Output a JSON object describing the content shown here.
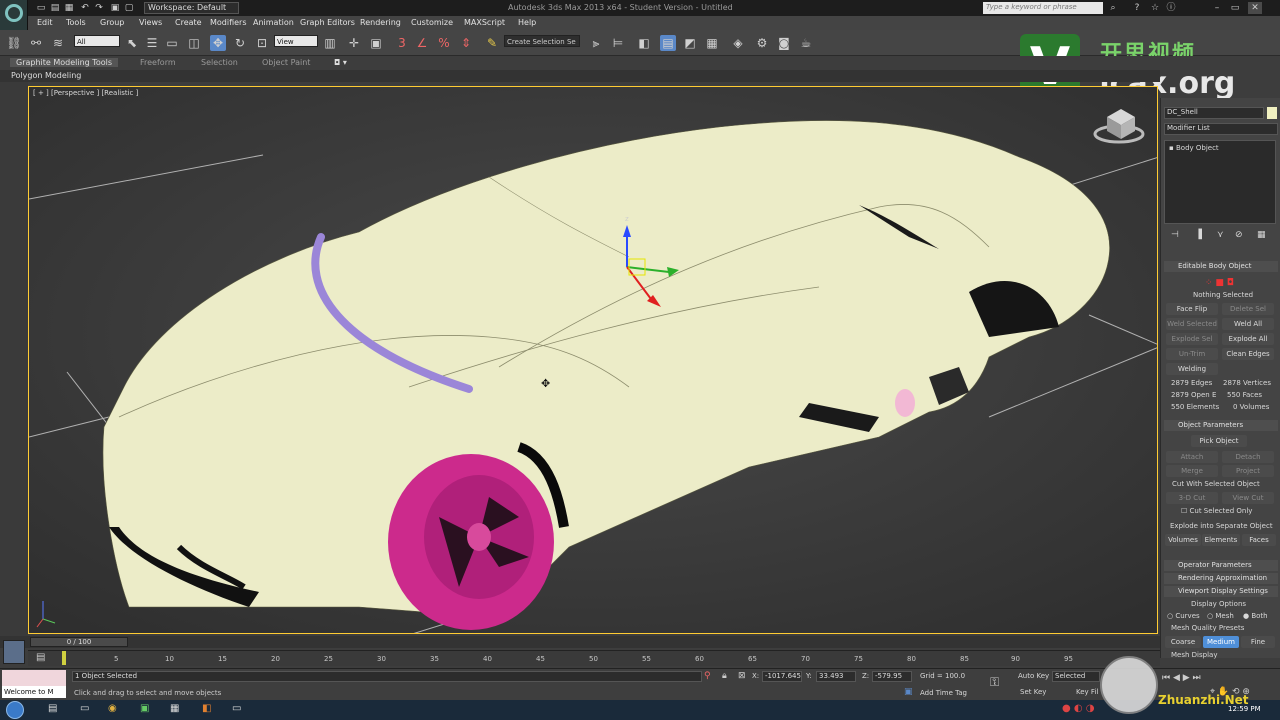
{
  "window": {
    "title": "Autodesk 3ds Max 2013 x64 - Student Version - Untitled",
    "workspace_label": "Workspace: Default",
    "search_placeholder": "Type a keyword or phrase"
  },
  "menu": [
    "Edit",
    "Tools",
    "Group",
    "Views",
    "Create",
    "Modifiers",
    "Animation",
    "Graph Editors",
    "Rendering",
    "Customize",
    "MAXScript",
    "Help"
  ],
  "toolbar": {
    "selection_filter": "All",
    "ref_coord": "View",
    "named_selection": "Create Selection Se"
  },
  "ribbon": {
    "tabs": [
      "Graphite Modeling Tools",
      "Freeform",
      "Selection",
      "Object Paint"
    ],
    "sub_label": "Polygon Modeling"
  },
  "viewport": {
    "label": "[ + ] [Perspective ] [Realistic ]",
    "car_body_color": "#ececc8",
    "wheel_color": "#cc2a8c",
    "trim_color": "#9b86d8",
    "gizmo_z": "z"
  },
  "logo": {
    "letter": "V",
    "cn_text": "开思视频",
    "url": ".icax.org"
  },
  "command_panel": {
    "object_name": "DC_Shell",
    "modifier_list": "Modifier List",
    "stack_item": "Body Object",
    "editable_title": "Editable Body Object",
    "nothing_selected": "Nothing Selected",
    "buttons_row1": [
      "Face Flip",
      "Delete Sel"
    ],
    "buttons_row2": [
      "Weld Selected",
      "Weld All"
    ],
    "buttons_row3": [
      "Explode Sel",
      "Explode All"
    ],
    "buttons_row4": [
      "Un-Trim",
      "Clean Edges"
    ],
    "welding": "Welding",
    "stats": [
      "2879 Edges",
      "2878 Vertices",
      "2879 Open E",
      "550 Faces",
      "550 Elements",
      "0 Volumes"
    ],
    "object_params_title": "Object Parameters",
    "pick_object": "Pick Object",
    "attach": "Attach",
    "detach": "Detach",
    "merge": "Merge",
    "project": "Project",
    "cut_with_selected": "Cut With Selected Object",
    "cut_3d": "3-D Cut",
    "view_cut": "View Cut",
    "cut_selected_only": "Cut Selected Only",
    "explode_into": "Explode into Separate Object",
    "explode_buttons": [
      "Volumes",
      "Elements",
      "Faces"
    ],
    "rollouts": [
      "Operator Parameters",
      "Rendering Approximation",
      "Viewport Display Settings"
    ],
    "display_options": "Display Options",
    "display_radio": [
      "Curves",
      "Mesh",
      "Both"
    ],
    "mesh_quality": "Mesh Quality Presets",
    "quality_buttons": [
      "Coarse",
      "Medium",
      "Fine"
    ],
    "mesh_display": "Mesh Display"
  },
  "timeline": {
    "slider": "0 / 100",
    "ticks": [
      "5",
      "10",
      "15",
      "20",
      "25",
      "30",
      "35",
      "40",
      "45",
      "50",
      "55",
      "60",
      "65",
      "70",
      "75",
      "80",
      "85",
      "90",
      "95"
    ]
  },
  "status": {
    "selected": "1 Object Selected",
    "prompt": "Click and drag to select and move objects",
    "x_label": "X:",
    "x_value": "-1017.645",
    "y_label": "Y:",
    "y_value": "33.493",
    "z_label": "Z:",
    "z_value": "-579.95",
    "grid": "Grid = 100.0",
    "add_time_tag": "Add Time Tag",
    "auto_key": "Auto Key",
    "set_key": "Set Key",
    "selected_dropdown": "Selected",
    "key_filters": "Key Fil",
    "welcome": "Welcome to M"
  },
  "taskbar": {
    "clock": "12:59 PM"
  },
  "watermark": "Zhuanzhi.Net"
}
